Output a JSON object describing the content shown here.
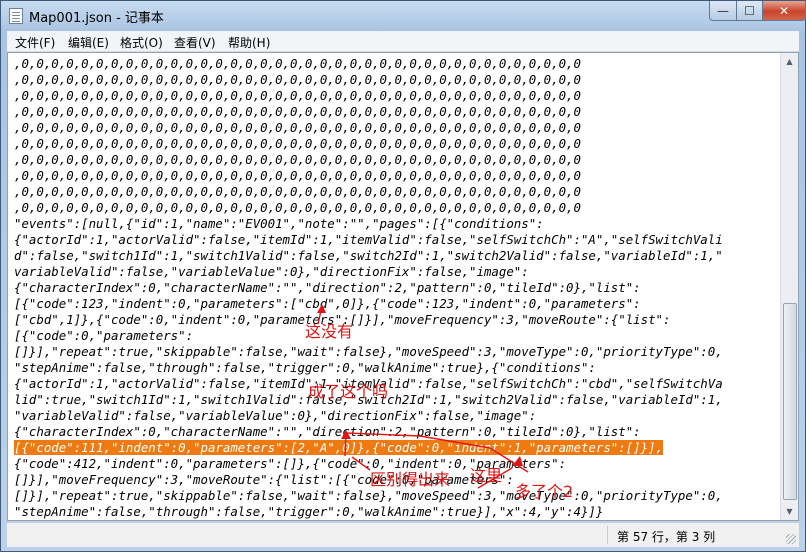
{
  "window": {
    "title": "Map001.json - 记事本",
    "minimize_glyph": "—",
    "maximize_glyph": "☐",
    "close_glyph": "✕"
  },
  "menu": {
    "items": [
      "文件(F)",
      "编辑(E)",
      "格式(O)",
      "查看(V)",
      "帮助(H)"
    ]
  },
  "editor": {
    "lines": [
      ",0,0,0,0,0,0,0,0,0,0,0,0,0,0,0,0,0,0,0,0,0,0,0,0,0,0,0,0,0,0,0,0,0,0,0,0,0,0",
      ",0,0,0,0,0,0,0,0,0,0,0,0,0,0,0,0,0,0,0,0,0,0,0,0,0,0,0,0,0,0,0,0,0,0,0,0,0,0",
      ",0,0,0,0,0,0,0,0,0,0,0,0,0,0,0,0,0,0,0,0,0,0,0,0,0,0,0,0,0,0,0,0,0,0,0,0,0,0",
      ",0,0,0,0,0,0,0,0,0,0,0,0,0,0,0,0,0,0,0,0,0,0,0,0,0,0,0,0,0,0,0,0,0,0,0,0,0,0",
      ",0,0,0,0,0,0,0,0,0,0,0,0,0,0,0,0,0,0,0,0,0,0,0,0,0,0,0,0,0,0,0,0,0,0,0,0,0,0",
      ",0,0,0,0,0,0,0,0,0,0,0,0,0,0,0,0,0,0,0,0,0,0,0,0,0,0,0,0,0,0,0,0,0,0,0,0,0,0",
      ",0,0,0,0,0,0,0,0,0,0,0,0,0,0,0,0,0,0,0,0,0,0,0,0,0,0,0,0,0,0,0,0,0,0,0,0,0,0",
      ",0,0,0,0,0,0,0,0,0,0,0,0,0,0,0,0,0,0,0,0,0,0,0,0,0,0,0,0,0,0,0,0,0,0,0,0,0,0",
      ",0,0,0,0,0,0,0,0,0,0,0,0,0,0,0,0,0,0,0,0,0,0,0,0,0,0,0,0,0,0,0,0,0,0,0,0,0,0",
      ",0,0,0,0,0,0,0,0,0,0,0,0,0,0,0,0,0,0,0,0,0,0,0,0,0,0,0,0,0,0,0,0,0,0,0,0,0,0",
      "\"events\":[null,{\"id\":1,\"name\":\"EV001\",\"note\":\"\",\"pages\":[{\"conditions\":",
      "{\"actorId\":1,\"actorValid\":false,\"itemId\":1,\"itemValid\":false,\"selfSwitchCh\":\"A\",\"selfSwitchVali",
      "d\":false,\"switch1Id\":1,\"switch1Valid\":false,\"switch2Id\":1,\"switch2Valid\":false,\"variableId\":1,\"",
      "variableValid\":false,\"variableValue\":0},\"directionFix\":false,\"image\":",
      "{\"characterIndex\":0,\"characterName\":\"\",\"direction\":2,\"pattern\":0,\"tileId\":0},\"list\":",
      "[{\"code\":123,\"indent\":0,\"parameters\":[\"cbd\",0]},{\"code\":123,\"indent\":0,\"parameters\":",
      "[\"cbd\",1]},{\"code\":0,\"indent\":0,\"parameters\":[]}],\"moveFrequency\":3,\"moveRoute\":{\"list\":",
      "[{\"code\":0,\"parameters\":",
      "[]}],\"repeat\":true,\"skippable\":false,\"wait\":false},\"moveSpeed\":3,\"moveType\":0,\"priorityType\":0,",
      "\"stepAnime\":false,\"through\":false,\"trigger\":0,\"walkAnime\":true},{\"conditions\":",
      "{\"actorId\":1,\"actorValid\":false,\"itemId\":1,\"itemValid\":false,\"selfSwitchCh\":\"cbd\",\"selfSwitchVa",
      "lid\":true,\"switch1Id\":1,\"switch1Valid\":false,\"switch2Id\":1,\"switch2Valid\":false,\"variableId\":1,",
      "\"variableValid\":false,\"variableValue\":0},\"directionFix\":false,\"image\":",
      "{\"characterIndex\":0,\"characterName\":\"\",\"direction\":2,\"pattern\":0,\"tileId\":0},\"list\":",
      "[{\"code\":111,\"indent\":0,\"parameters\":[2,\"A\",0]},{\"code\":0,\"indent\":1,\"parameters\":[]}],",
      "{\"code\":412,\"indent\":0,\"parameters\":[]},{\"code\":0,\"indent\":0,\"parameters\":",
      "[]}],\"moveFrequency\":3,\"moveRoute\":{\"list\":[{\"code\":0,\"parameters\":",
      "[]}],\"repeat\":true,\"skippable\":false,\"wait\":false},\"moveSpeed\":3,\"moveType\":0,\"priorityType\":0,",
      "\"stepAnime\":false,\"through\":false,\"trigger\":0,\"walkAnime\":true}],\"x\":4,\"y\":4}]}"
    ],
    "highlight_line": 24
  },
  "annotations": [
    {
      "text": "这没有"
    },
    {
      "text": "成了这个吗"
    },
    {
      "text": "区别得出来"
    },
    {
      "text": "这里"
    },
    {
      "text": "多了个2"
    }
  ],
  "annotation_color": "#e01414",
  "highlight_color": "#f07a12",
  "status": {
    "position": "第 57 行，第 3 列"
  }
}
